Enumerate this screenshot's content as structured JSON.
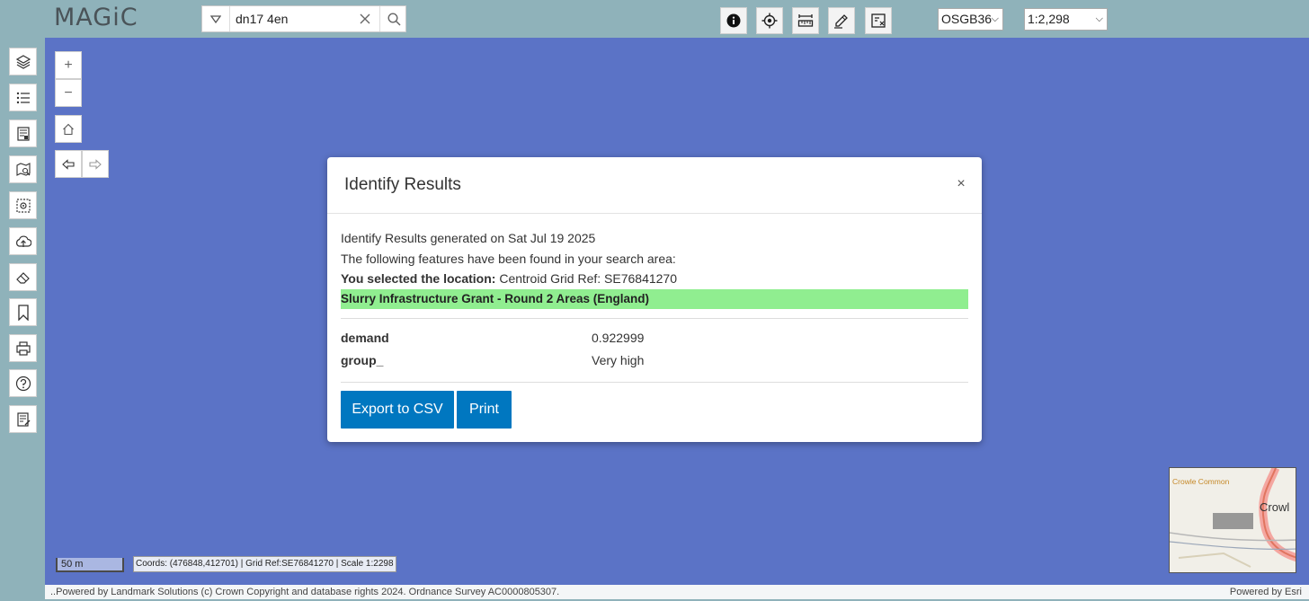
{
  "app": {
    "logo_text": "MAGiC"
  },
  "search": {
    "value": "dn17 4en"
  },
  "toolbar": {
    "tools": [
      "info-icon",
      "locate-icon",
      "measure-icon",
      "draw-icon",
      "map-tools-icon"
    ],
    "coord_system": "OSGB36",
    "scale": "1:2,298"
  },
  "sidebar": {
    "items": [
      "layers-icon",
      "legend-list-icon",
      "map-layers-catalogue-icon",
      "search-map-icon",
      "identify-map-icon",
      "upload-icon",
      "erase-icon",
      "bookmark-icon",
      "print-icon",
      "help-icon",
      "report-icon"
    ]
  },
  "map_controls": {
    "zoom_in": "+",
    "zoom_out": "−"
  },
  "status": {
    "scale_label": "50 m",
    "coords_text": "Coords: (476848,412701) | Grid Ref:SE76841270 | Scale 1:2298"
  },
  "footer": {
    "attribution": "..Powered by Landmark Solutions (c) Crown Copyright and database rights 2024. Ordnance Survey AC0000805307.",
    "powered_by": "Powered by Esri"
  },
  "overview_map": {
    "label_common": "Crowle Common",
    "label_town": "Crowl"
  },
  "dialog": {
    "title": "Identify Results",
    "close": "×",
    "generated_text": "Identify Results generated on Sat Jul 19 2025",
    "features_text": "The following features have been found in your search area:",
    "location_label": "You selected the location:",
    "location_value": " Centroid Grid Ref: SE76841270",
    "layer_name": "Slurry Infrastructure Grant - Round 2 Areas (England)",
    "attributes": [
      {
        "name": "demand",
        "value": "0.922999"
      },
      {
        "name": "group_",
        "value": "Very high"
      }
    ],
    "export_label": "Export to CSV",
    "print_label": "Print"
  },
  "colors": {
    "header_bg": "#8fb2ba",
    "map_bg": "#5b73c6",
    "layer_highlight": "#90ee90",
    "button_primary": "#0077c0"
  }
}
